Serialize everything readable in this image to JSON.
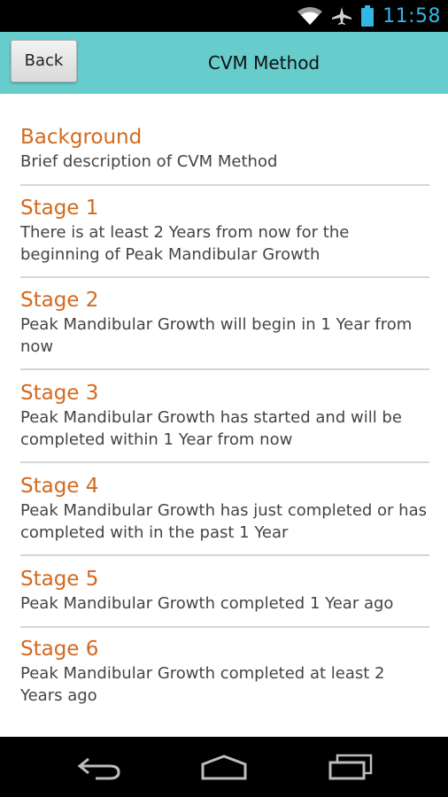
{
  "status_bar": {
    "time": "11:58",
    "icons": [
      "wifi-icon",
      "airplane-icon",
      "battery-icon"
    ],
    "accent_color": "#33b5e5"
  },
  "header": {
    "back_label": "Back",
    "title": "CVM Method",
    "background_color": "#66cccc"
  },
  "items": [
    {
      "title": "Background",
      "description": "Brief description of CVM Method"
    },
    {
      "title": "Stage 1",
      "description": "There is at least 2 Years from now for the beginning of Peak Mandibular Growth"
    },
    {
      "title": "Stage 2",
      "description": "Peak Mandibular Growth will begin in 1 Year from now"
    },
    {
      "title": "Stage 3",
      "description": "Peak Mandibular Growth has started and will be completed within 1 Year from now"
    },
    {
      "title": "Stage 4",
      "description": "Peak Mandibular Growth has just completed or has completed with in the past 1 Year"
    },
    {
      "title": "Stage 5",
      "description": "Peak Mandibular Growth completed 1 Year ago"
    },
    {
      "title": "Stage 6",
      "description": "Peak Mandibular Growth completed at least 2 Years ago"
    }
  ],
  "title_color": "#d2691e",
  "nav_bar": {
    "buttons": [
      "back-icon",
      "home-icon",
      "recent-apps-icon"
    ]
  }
}
